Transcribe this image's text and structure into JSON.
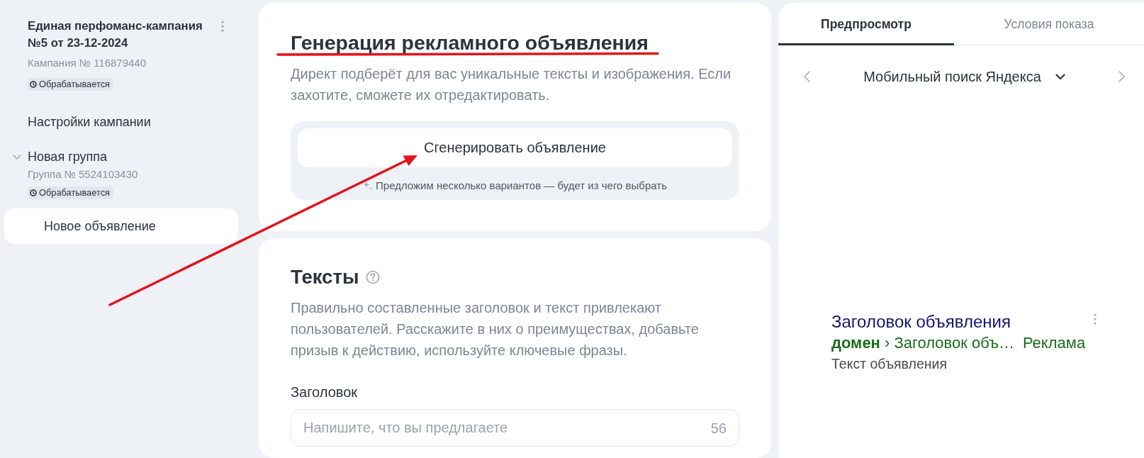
{
  "sidebar": {
    "campaign": {
      "title": "Единая перфоманс-кампания №5 от 23-12-2024",
      "number": "Кампания № 116879440",
      "status": "Обрабатывается"
    },
    "items": [
      {
        "kind": "link",
        "label": "Настройки кампании",
        "selected": false
      },
      {
        "kind": "group",
        "label": "Новая группа",
        "selected": false,
        "expanded": true,
        "number": "Группа № 5524103430",
        "status": "Обрабатывается",
        "children": [
          {
            "label": "Новое объявление",
            "selected": true
          }
        ]
      }
    ]
  },
  "generation": {
    "title": "Генерация рекламного объявления",
    "description": "Директ подберёт для вас уникальные тексты и изображения. Если захотите, сможете их отредактировать.",
    "button": "Сгенерировать объявление",
    "hint": "Предложим несколько вариантов — будет из чего выбрать"
  },
  "texts": {
    "title": "Тексты",
    "description": "Правильно составленные заголовок и текст привлекают пользователей. Расскажите в них о преимуществах, добавьте призыв к действию, используйте ключевые фразы.",
    "fields": [
      {
        "label": "Заголовок",
        "placeholder": "Напишите, что вы предлагаете",
        "counter": "56"
      }
    ]
  },
  "preview": {
    "tabs": [
      {
        "label": "Предпросмотр",
        "selected": true
      },
      {
        "label": "Условия показа",
        "selected": false
      }
    ],
    "platform": "Мобильный поиск Яндекса",
    "ad": {
      "title": "Заголовок объявления",
      "url": "**домен** › Заголовок объ…",
      "label": "Реклама",
      "text": "Текст объявления"
    }
  }
}
